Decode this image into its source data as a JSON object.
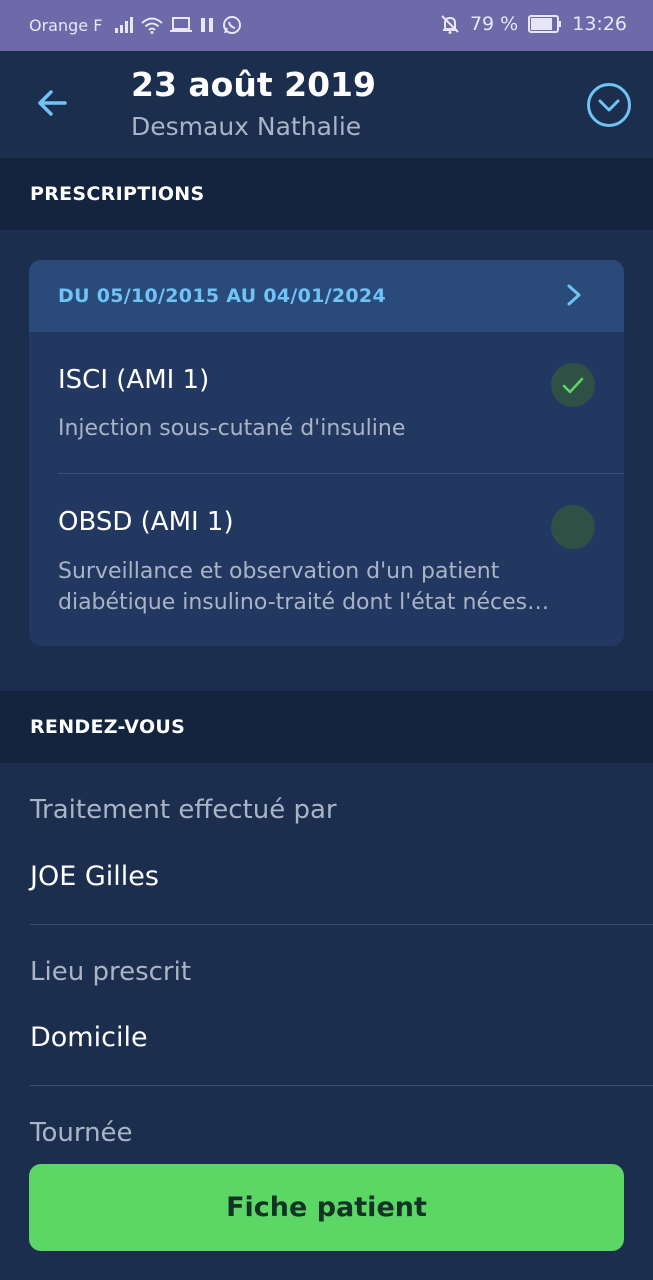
{
  "status_bar": {
    "carrier": "Orange F",
    "battery": "79 %",
    "time": "13:26"
  },
  "header": {
    "title": "23 août 2019",
    "subtitle": "Desmaux Nathalie"
  },
  "prescriptions": {
    "section_title": "PRESCRIPTIONS",
    "range_label": "DU 05/10/2015 AU 04/01/2024",
    "items": [
      {
        "code": "ISCI (AMI 1)",
        "description": "Injection sous-cutané d'insuline",
        "checked": true
      },
      {
        "code": "OBSD (AMI 1)",
        "description": "Surveillance et observation d'un patient diabétique insulino-traité dont l'état néces…",
        "checked": false
      }
    ]
  },
  "rendezvous": {
    "section_title": "RENDEZ-VOUS",
    "fields": [
      {
        "label": "Traitement effectué par",
        "value": "JOE Gilles"
      },
      {
        "label": "Lieu prescrit",
        "value": "Domicile"
      },
      {
        "label": "Tournée",
        "value": ""
      }
    ]
  },
  "actions": {
    "fiche_patient": "Fiche patient"
  },
  "colors": {
    "background": "#1c2e4e",
    "accent_blue": "#6fc3f5",
    "accent_green": "#5cd665",
    "status_bar": "#6c6aa8"
  }
}
